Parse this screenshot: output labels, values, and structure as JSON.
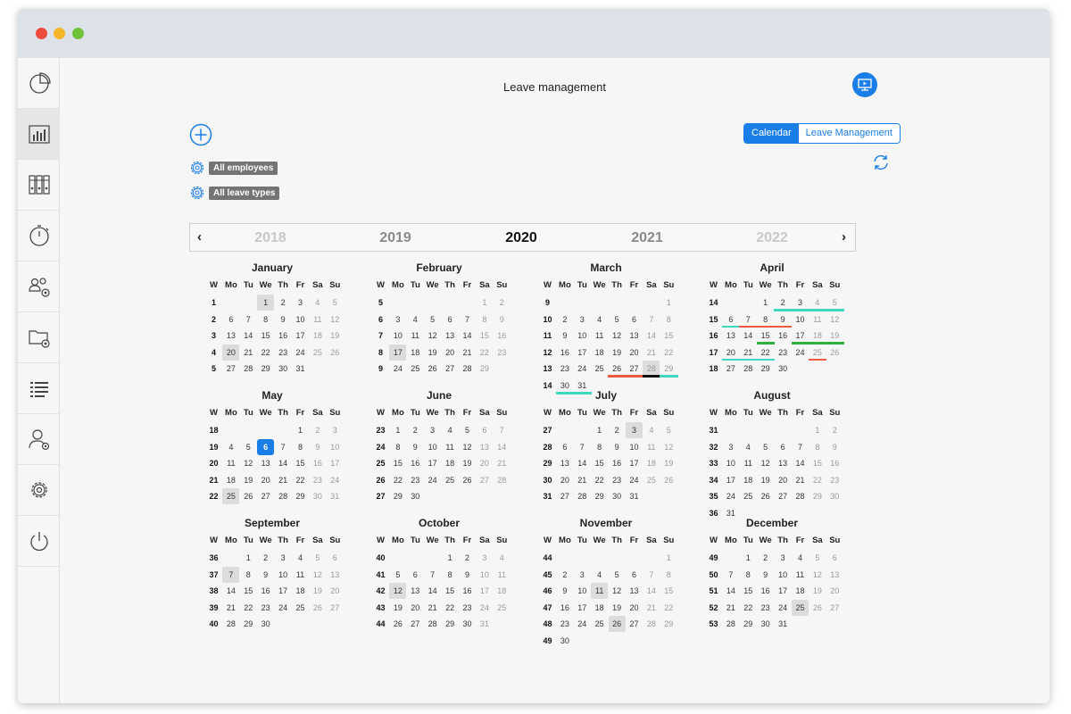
{
  "app": {
    "title": "Leave management"
  },
  "sidebar": {
    "items": [
      {
        "icon": "pie-chart-icon",
        "active": false
      },
      {
        "icon": "bar-chart-icon",
        "active": true
      },
      {
        "icon": "binders-icon",
        "active": false
      },
      {
        "icon": "stopwatch-icon",
        "active": false
      },
      {
        "icon": "team-settings-icon",
        "active": false
      },
      {
        "icon": "folder-settings-icon",
        "active": false
      },
      {
        "icon": "list-icon",
        "active": false
      },
      {
        "icon": "user-settings-icon",
        "active": false
      },
      {
        "icon": "gear-icon",
        "active": false
      },
      {
        "icon": "power-icon",
        "active": false
      }
    ]
  },
  "toolbar": {
    "add_icon": "plus-circle-icon",
    "help_icon": "video-help-icon",
    "refresh_icon": "refresh-icon",
    "views": [
      {
        "label": "Calendar",
        "active": true
      },
      {
        "label": "Leave Management",
        "active": false
      }
    ]
  },
  "filters": [
    {
      "label": "All employees",
      "icon": "gear-icon"
    },
    {
      "label": "All leave types",
      "icon": "gear-icon"
    }
  ],
  "years": {
    "prev_arrow": "‹",
    "next_arrow": "›",
    "items": [
      {
        "label": "2018",
        "state": "faded"
      },
      {
        "label": "2019",
        "state": "normal"
      },
      {
        "label": "2020",
        "state": "current"
      },
      {
        "label": "2021",
        "state": "normal"
      },
      {
        "label": "2022",
        "state": "faded"
      }
    ]
  },
  "calendar": {
    "week_header": [
      "W",
      "Mo",
      "Tu",
      "We",
      "Th",
      "Fr",
      "Sa",
      "Su"
    ],
    "today": {
      "month": 4,
      "day": 6
    },
    "colors": {
      "accent": "#1a7ee8",
      "teal": "#3ed8c0",
      "red": "#ee5a3e",
      "green": "#2bb33a",
      "black": "#111111",
      "highlight": "#dcdcdc"
    },
    "months": [
      {
        "name": "January",
        "start": 2,
        "days": 31,
        "weeks": [
          1,
          2,
          3,
          4,
          5
        ],
        "highlight": [
          1,
          20
        ]
      },
      {
        "name": "February",
        "start": 5,
        "days": 29,
        "weeks": [
          5,
          6,
          7,
          8,
          9
        ],
        "highlight": [
          17
        ]
      },
      {
        "name": "March",
        "start": 6,
        "days": 31,
        "weeks": [
          9,
          10,
          11,
          12,
          13,
          14
        ],
        "highlight": [
          28
        ]
      },
      {
        "name": "April",
        "start": 2,
        "days": 30,
        "weeks": [
          14,
          15,
          16,
          17,
          18
        ],
        "highlight": []
      },
      {
        "name": "May",
        "start": 4,
        "days": 31,
        "weeks": [
          18,
          19,
          20,
          21,
          22
        ],
        "highlight": [
          25
        ]
      },
      {
        "name": "June",
        "start": 0,
        "days": 30,
        "weeks": [
          23,
          24,
          25,
          26,
          27
        ],
        "highlight": []
      },
      {
        "name": "July",
        "start": 2,
        "days": 31,
        "weeks": [
          27,
          28,
          29,
          30,
          31
        ],
        "highlight": [
          3
        ]
      },
      {
        "name": "August",
        "start": 5,
        "days": 31,
        "weeks": [
          31,
          32,
          33,
          34,
          35,
          36
        ],
        "highlight": []
      },
      {
        "name": "September",
        "start": 1,
        "days": 30,
        "weeks": [
          36,
          37,
          38,
          39,
          40
        ],
        "highlight": [
          7
        ]
      },
      {
        "name": "October",
        "start": 3,
        "days": 31,
        "weeks": [
          40,
          41,
          42,
          43,
          44
        ],
        "highlight": [
          12
        ]
      },
      {
        "name": "November",
        "start": 6,
        "days": 30,
        "weeks": [
          44,
          45,
          46,
          47,
          48,
          49
        ],
        "highlight": [
          11,
          26
        ]
      },
      {
        "name": "December",
        "start": 1,
        "days": 31,
        "weeks": [
          49,
          50,
          51,
          52,
          53
        ],
        "highlight": [
          25
        ]
      }
    ],
    "leave_marks": [
      {
        "month": 2,
        "days": [
          26,
          27
        ],
        "color": "red"
      },
      {
        "month": 2,
        "days": [
          28
        ],
        "color": "black"
      },
      {
        "month": 2,
        "days": [
          29
        ],
        "color": "teal"
      },
      {
        "month": 2,
        "days": [
          30,
          31
        ],
        "color": "teal"
      },
      {
        "month": 3,
        "days": [
          2,
          3,
          4,
          5
        ],
        "color": "teal"
      },
      {
        "month": 3,
        "days": [
          6
        ],
        "color": "teal"
      },
      {
        "month": 3,
        "days": [
          7
        ],
        "color": "red"
      },
      {
        "month": 3,
        "days": [
          8,
          9
        ],
        "color": "red"
      },
      {
        "month": 3,
        "days": [
          15
        ],
        "color": "green"
      },
      {
        "month": 3,
        "days": [
          17,
          18,
          19
        ],
        "color": "green"
      },
      {
        "month": 3,
        "days": [
          20,
          21,
          22
        ],
        "color": "teal"
      },
      {
        "month": 3,
        "days": [
          25
        ],
        "color": "red"
      }
    ]
  }
}
